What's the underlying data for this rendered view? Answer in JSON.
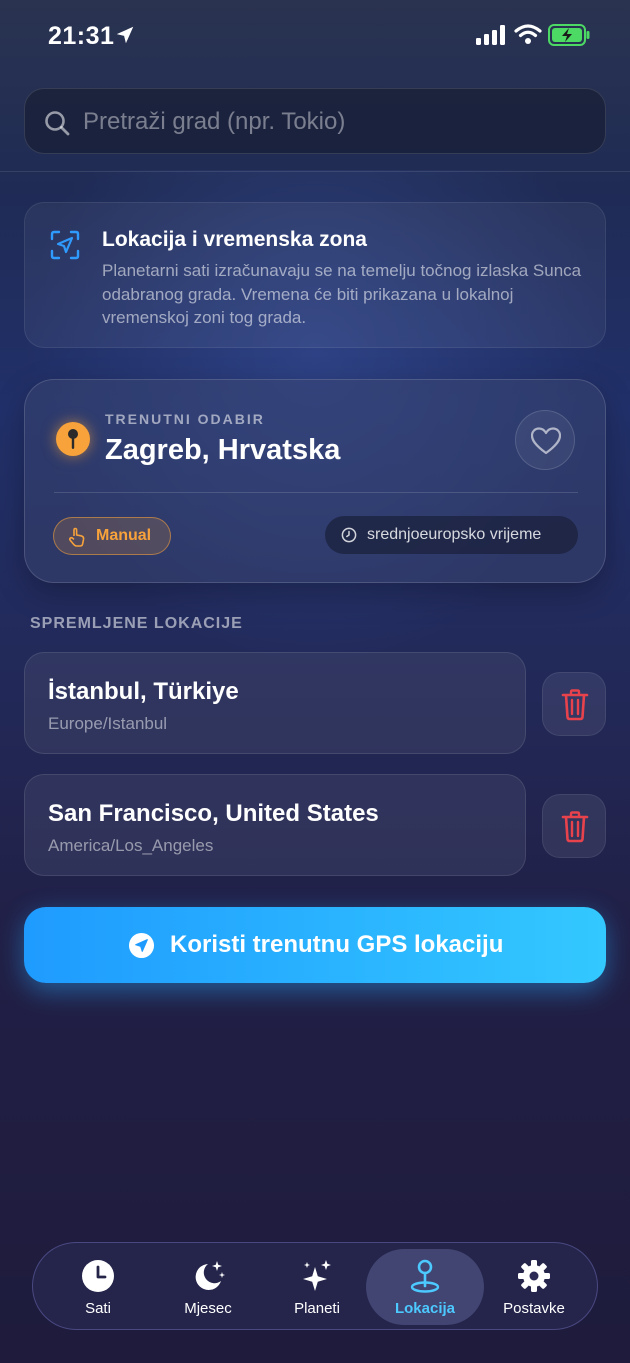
{
  "status_bar": {
    "time": "21:31"
  },
  "search": {
    "placeholder": "Pretraži grad (npr. Tokio)"
  },
  "info_card": {
    "title": "Lokacija i vremenska zona",
    "description": "Planetarni sati izračunavaju se na temelju točnog izlaska Sunca odabranog grada. Vremena će biti prikazana u lokalnoj vremenskoj zoni tog grada."
  },
  "current": {
    "kicker": "TRENUTNI ODABIR",
    "city": "Zagreb, Hrvatska",
    "mode_badge": "Manual",
    "timezone_badge": "srednjoeuropsko vrijeme"
  },
  "saved": {
    "section_title": "SPREMLJENE LOKACIJE",
    "items": [
      {
        "name": "İstanbul, Türkiye",
        "timezone": "Europe/Istanbul"
      },
      {
        "name": "San Francisco, United States",
        "timezone": "America/Los_Angeles"
      }
    ]
  },
  "gps_button": {
    "label": "Koristi trenutnu GPS lokaciju"
  },
  "tabs": [
    {
      "label": "Sati",
      "icon": "clock-icon"
    },
    {
      "label": "Mjesec",
      "icon": "moon-stars-icon"
    },
    {
      "label": "Planeti",
      "icon": "sparkles-icon"
    },
    {
      "label": "Lokacija",
      "icon": "location-pin-icon",
      "active": true
    },
    {
      "label": "Postavke",
      "icon": "gear-icon"
    }
  ],
  "colors": {
    "accent": "#f7a23a",
    "primary_button": "#1f9bff",
    "active_tab": "#4cc9ff",
    "delete": "#e8424c"
  }
}
